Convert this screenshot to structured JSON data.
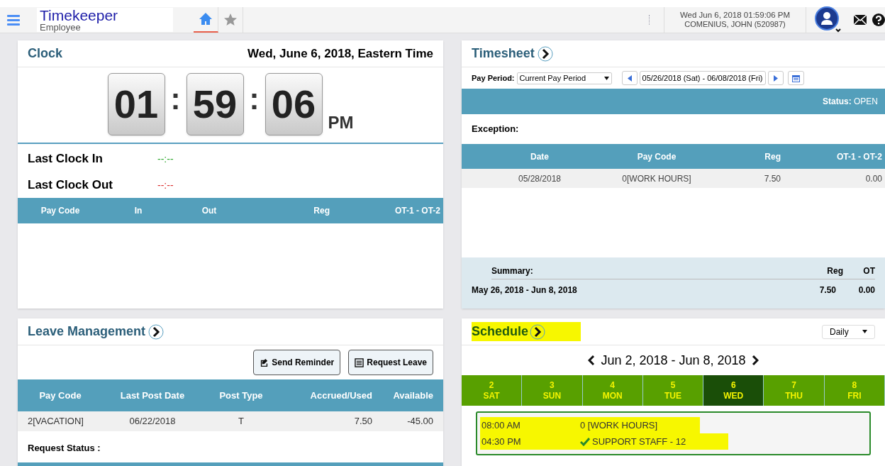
{
  "header": {
    "app_title": "Timekeeper",
    "app_subtitle": "Employee",
    "tabs": [
      {
        "kind": "home",
        "selected": true
      },
      {
        "kind": "star",
        "selected": false
      }
    ],
    "datetime": "Wed Jun 6, 2018 01:59:06 PM",
    "user": "COMENIUS, JOHN (520987)"
  },
  "clock": {
    "title": "Clock",
    "date": "Wed, June 6, 2018, Eastern Time",
    "hours": "01",
    "minutes": "59",
    "seconds": "06",
    "separator": ":",
    "ampm": "PM",
    "last_in_label": "Last Clock In",
    "last_in_value": "--:--",
    "last_out_label": "Last Clock Out",
    "last_out_value": "--:--",
    "columns": [
      "Pay Code",
      "In",
      "Out",
      "Reg",
      "OT-1 - OT-2"
    ]
  },
  "timesheet": {
    "title": "Timesheet",
    "pay_period_label": "Pay Period:",
    "pay_period_value": "Current Pay Period",
    "date_range": "05/26/2018 (Sat) - 06/08/2018 (Fri)",
    "status_label": "Status:",
    "status_value": "OPEN",
    "exception_label": "Exception:",
    "columns": [
      "Date",
      "Pay Code",
      "Reg",
      "OT-1 - OT-2"
    ],
    "rows": [
      [
        "05/28/2018",
        "0[WORK HOURS]",
        "7.50",
        "0.00"
      ]
    ],
    "summary": {
      "label": "Summary:",
      "columns": [
        "Reg",
        "OT"
      ],
      "period": "May 26, 2018 - Jun 8, 2018",
      "reg": "7.50",
      "ot": "0.00"
    }
  },
  "leave": {
    "title": "Leave Management",
    "buttons": [
      {
        "kind": "reminder",
        "label": "Send Reminder"
      },
      {
        "kind": "request",
        "label": "Request Leave"
      }
    ],
    "columns": [
      "Pay Code",
      "Last Post Date",
      "Post Type",
      "Accrued/Used",
      "Available"
    ],
    "rows": [
      [
        "2[VACATION]",
        "06/22/2018",
        "T",
        "7.50",
        "-45.00"
      ]
    ],
    "request_status_label": "Request Status :"
  },
  "schedule": {
    "title": "Schedule",
    "highlighted": true,
    "view": "Daily",
    "range": "Jun 2, 2018 - Jun 8, 2018",
    "days": [
      {
        "num": "2",
        "name": "SAT",
        "selected": false
      },
      {
        "num": "3",
        "name": "SUN",
        "selected": false
      },
      {
        "num": "4",
        "name": "MON",
        "selected": false
      },
      {
        "num": "5",
        "name": "TUE",
        "selected": false
      },
      {
        "num": "6",
        "name": "WED",
        "selected": true
      },
      {
        "num": "7",
        "name": "THU",
        "selected": false
      },
      {
        "num": "8",
        "name": "FRI",
        "selected": false
      }
    ],
    "entries": [
      {
        "time": "08:00 AM",
        "text": "0 [WORK HOURS]",
        "checked": false,
        "highlighted": true
      },
      {
        "time": "04:30 PM",
        "text": "SUPPORT STAFF - 12",
        "checked": true,
        "highlighted": true
      }
    ]
  }
}
